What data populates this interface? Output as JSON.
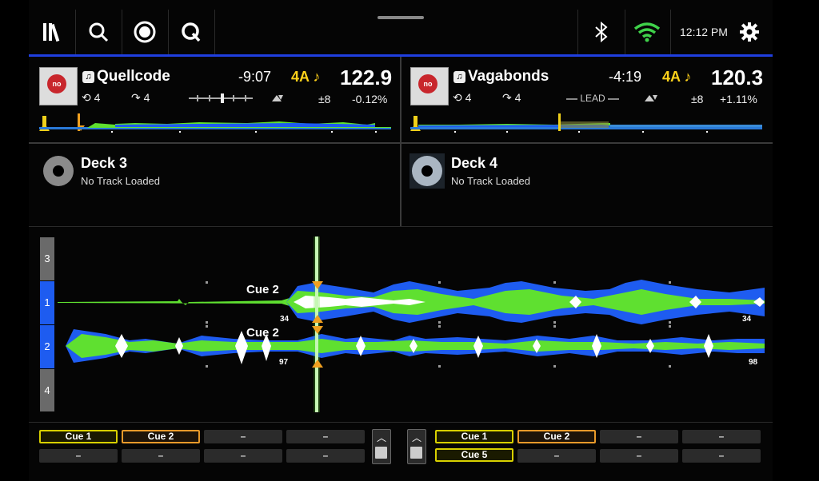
{
  "status": {
    "time": "12:12 PM"
  },
  "deck1": {
    "title": "Quellcode",
    "remaining": "-9:07",
    "key": "4A",
    "bpm": "122.9",
    "loop": "4",
    "jump": "4",
    "pitch_range": "±8",
    "pitch": "-0.12%",
    "art_text": "no"
  },
  "deck2": {
    "title": "Vagabonds",
    "remaining": "-4:19",
    "key": "4A",
    "bpm": "120.3",
    "loop": "4",
    "jump": "4",
    "lead": "LEAD",
    "pitch_range": "±8",
    "pitch": "+1.11%",
    "art_text": "no"
  },
  "deck3": {
    "title": "Deck 3",
    "status": "No Track Loaded"
  },
  "deck4": {
    "title": "Deck 4",
    "status": "No Track Loaded"
  },
  "lanes": [
    "3",
    "1",
    "2",
    "4"
  ],
  "waveform": {
    "cue_label_top": "Cue 2",
    "cue_label_bottom": "Cue 2",
    "beat_top_left": "34",
    "beat_bottom_left": "97",
    "beat_top_right": "34",
    "beat_bottom_right": "98"
  },
  "pads_left": [
    [
      "Cue 1",
      "Cue 2",
      "–",
      "–"
    ],
    [
      "–",
      "–",
      "–",
      "–"
    ]
  ],
  "pads_right": [
    [
      "Cue 1",
      "Cue 2",
      "–",
      "–"
    ],
    [
      "Cue 5",
      "–",
      "–",
      "–"
    ]
  ],
  "colors": {
    "accent": "#1f3fe0",
    "key": "#ffd21a",
    "wave_blue": "#1e5cf0",
    "wave_green": "#5fe030",
    "cue_orange": "#f0a020",
    "pad_yellow": "#d8d000",
    "pad_orange": "#e89a2a",
    "wifi": "#3fd24a"
  }
}
